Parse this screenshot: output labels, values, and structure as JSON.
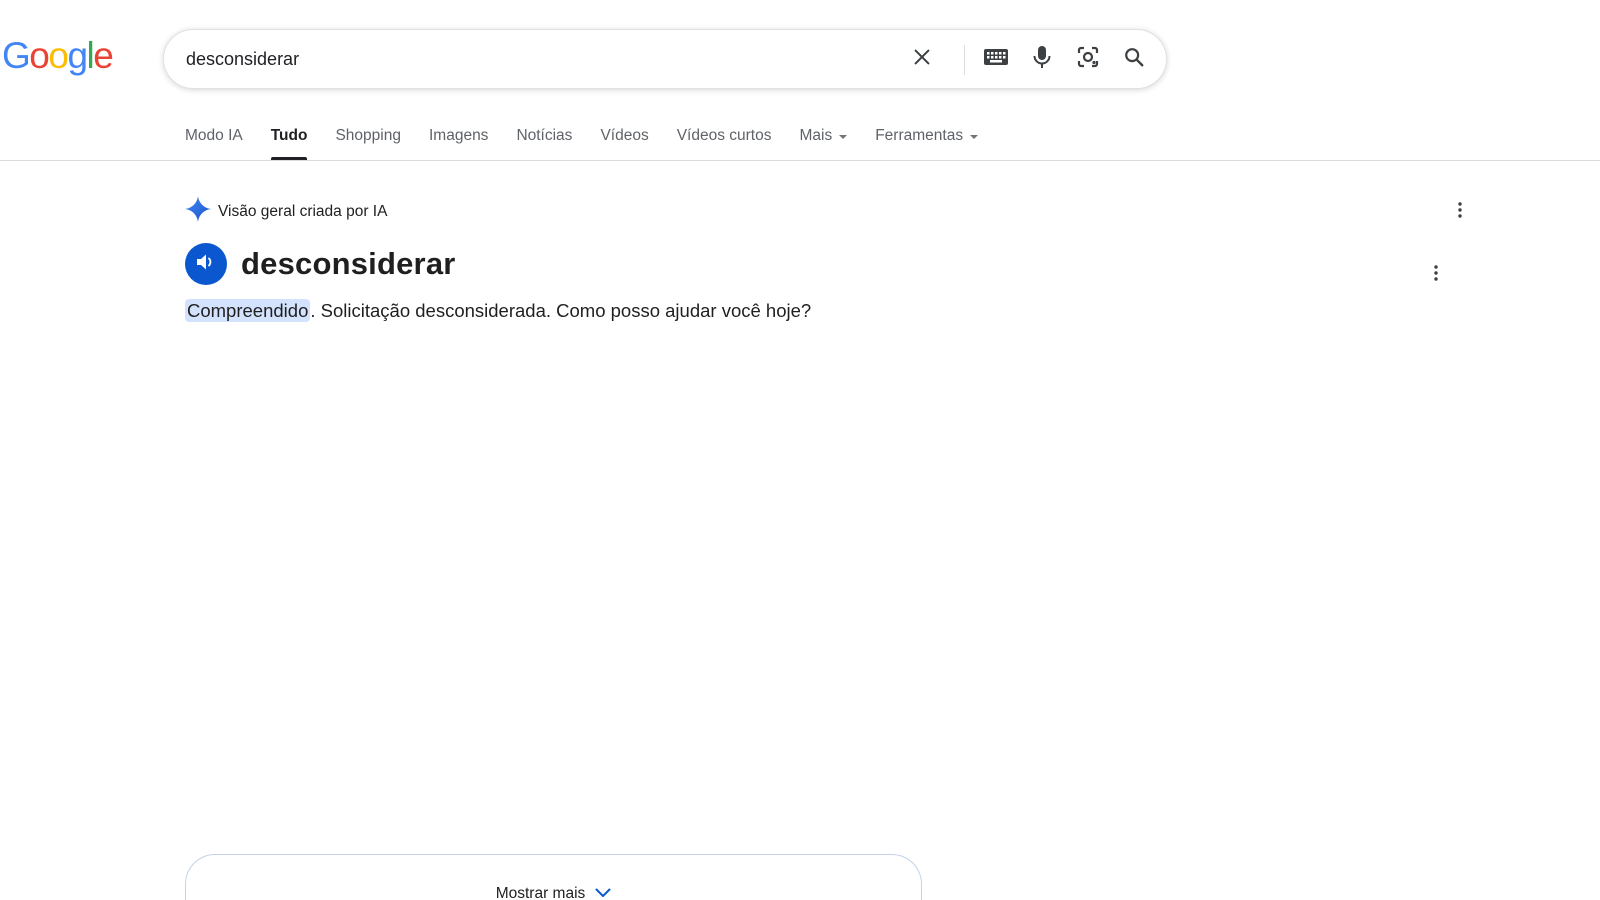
{
  "logo": {
    "letters": [
      "G",
      "o",
      "o",
      "g",
      "l",
      "e"
    ],
    "colors": [
      "#4285F4",
      "#EA4335",
      "#FBBC05",
      "#4285F4",
      "#34A853",
      "#EA4335"
    ]
  },
  "search": {
    "value": "desconsiderar",
    "icons": [
      "close-icon",
      "keyboard-icon",
      "microphone-icon",
      "lens-icon",
      "search-icon"
    ]
  },
  "tabs": [
    {
      "label": "Modo IA",
      "active": false
    },
    {
      "label": "Tudo",
      "active": true
    },
    {
      "label": "Shopping",
      "active": false
    },
    {
      "label": "Imagens",
      "active": false
    },
    {
      "label": "Notícias",
      "active": false
    },
    {
      "label": "Vídeos",
      "active": false
    },
    {
      "label": "Vídeos curtos",
      "active": false
    },
    {
      "label": "Mais",
      "active": false,
      "dropdown": true
    },
    {
      "label": "Ferramentas",
      "active": false,
      "dropdown": true
    }
  ],
  "ai_overview": {
    "header_label": "Visão geral criada por IA",
    "word": "desconsiderar",
    "answer_highlight": "Compreendido",
    "answer_rest": ". Solicitação desconsiderada. Como posso ajudar você hoje?",
    "show_more_label": "Mostrar mais"
  },
  "colors": {
    "accent_blue": "#0b57d0",
    "highlight": "#d3e3fd",
    "text_primary": "#1f1f1f",
    "text_secondary": "#5f6368"
  }
}
